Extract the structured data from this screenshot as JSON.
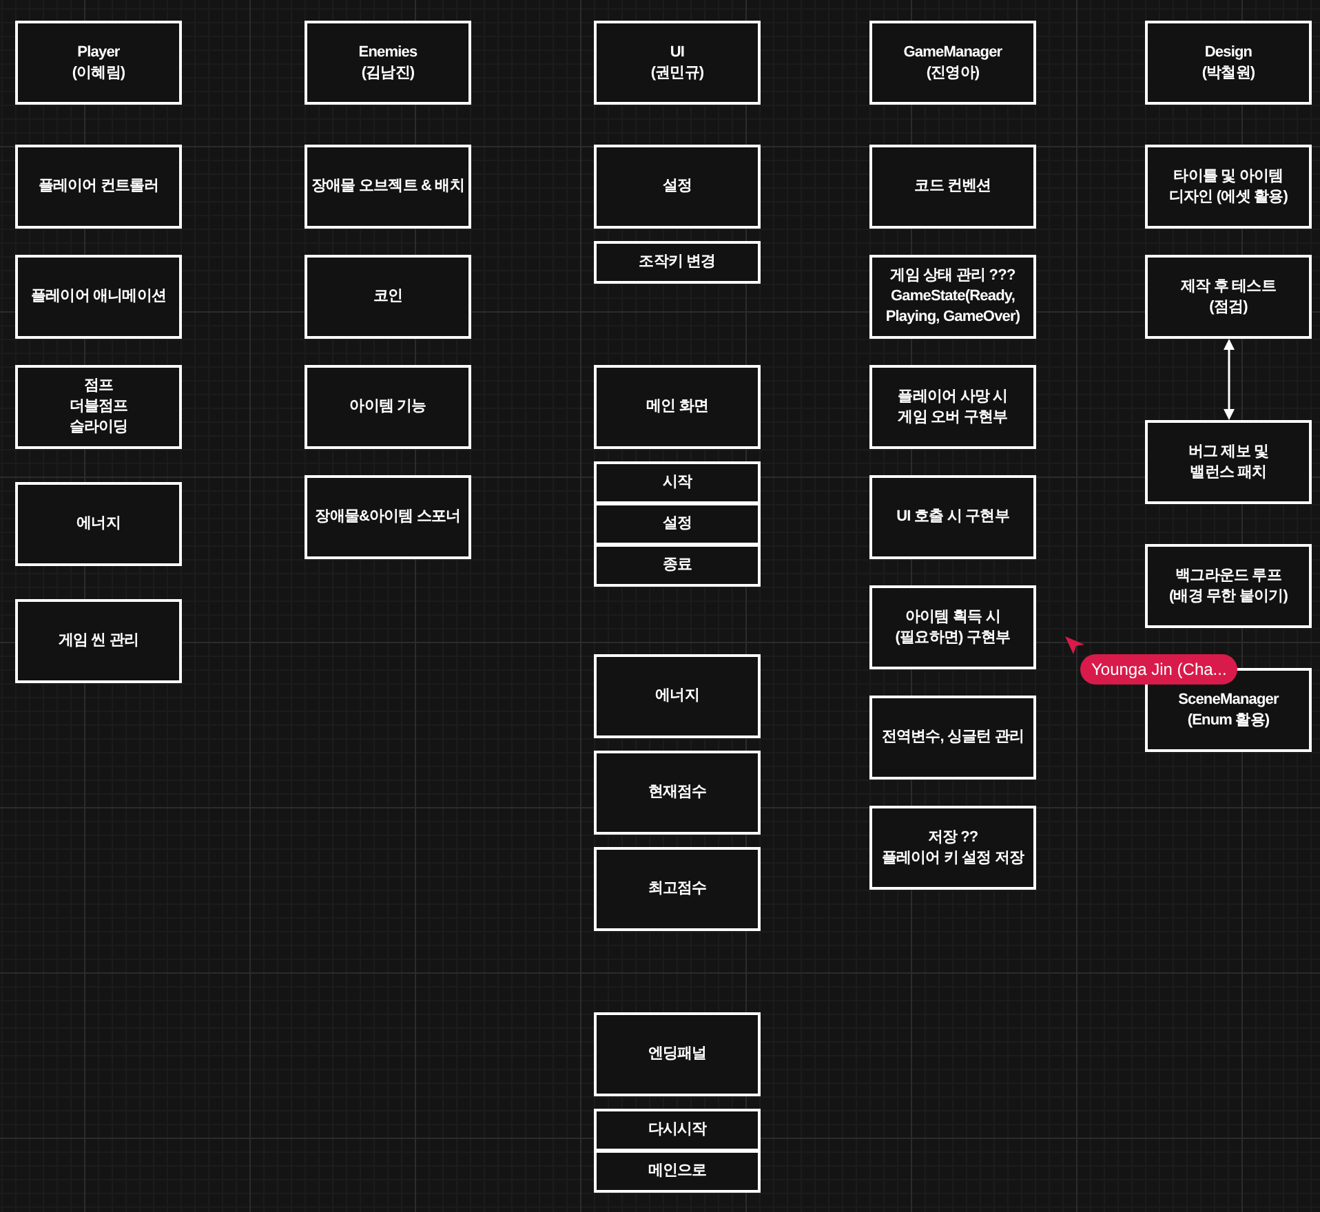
{
  "columns": [
    {
      "items": [
        {
          "kind": "box",
          "text": "Player\n(이혜림)"
        },
        {
          "kind": "box",
          "text": "플레이어 컨트롤러"
        },
        {
          "kind": "box",
          "text": "플레이어 애니메이션"
        },
        {
          "kind": "box",
          "text": "점프\n더블점프\n슬라이딩"
        },
        {
          "kind": "box",
          "text": "에너지"
        },
        {
          "kind": "box",
          "text": "게임 씬 관리"
        }
      ]
    },
    {
      "items": [
        {
          "kind": "box",
          "text": "Enemies\n(김남진)"
        },
        {
          "kind": "box",
          "text": "장애물 오브젝트 & 배치"
        },
        {
          "kind": "box",
          "text": "코인"
        },
        {
          "kind": "box",
          "text": "아이템 기능"
        },
        {
          "kind": "box",
          "text": "장애물&아이템 스포너"
        }
      ]
    },
    {
      "items": [
        {
          "kind": "box",
          "text": "UI\n(권민규)"
        },
        {
          "kind": "box",
          "text": "설정"
        },
        {
          "kind": "row",
          "text": "조작키 변경"
        },
        {
          "kind": "box",
          "text": "메인 화면"
        },
        {
          "kind": "row",
          "text": "시작"
        },
        {
          "kind": "row",
          "text": "설정"
        },
        {
          "kind": "row",
          "text": "종료"
        },
        {
          "kind": "box",
          "text": "에너지"
        },
        {
          "kind": "box",
          "text": "현재점수"
        },
        {
          "kind": "box",
          "text": "최고점수"
        },
        {
          "kind": "box",
          "text": "엔딩패널"
        },
        {
          "kind": "row",
          "text": "다시시작"
        },
        {
          "kind": "row",
          "text": "메인으로"
        }
      ]
    },
    {
      "items": [
        {
          "kind": "box",
          "text": "GameManager\n(진영아)"
        },
        {
          "kind": "box",
          "text": "코드 컨벤션"
        },
        {
          "kind": "box",
          "text": "게임 상태 관리 ???\nGameState(Ready,\nPlaying, GameOver)"
        },
        {
          "kind": "box",
          "text": "플레이어 사망 시\n게임 오버 구현부"
        },
        {
          "kind": "box",
          "text": "UI 호출 시 구현부"
        },
        {
          "kind": "box",
          "text": "아이템 획득 시\n(필요하면) 구현부"
        },
        {
          "kind": "box",
          "text": "전역변수, 싱글턴 관리"
        },
        {
          "kind": "box",
          "text": "저장 ??\n플레이어 키 설정 저장"
        }
      ]
    },
    {
      "items": [
        {
          "kind": "box",
          "text": "Design\n(박철원)"
        },
        {
          "kind": "box",
          "text": "타이틀 및 아이템\n디자인 (에셋 활용)"
        },
        {
          "kind": "box",
          "text": "제작 후 테스트\n(점검)",
          "two_way_arrow_below": true
        },
        {
          "kind": "box",
          "text": "버그 제보 및\n밸런스 패치"
        },
        {
          "kind": "box",
          "text": "백그라운드 루프\n(배경 무한 붙이기)"
        },
        {
          "kind": "box",
          "text": "SceneManager\n(Enum 활용)"
        }
      ]
    }
  ],
  "collaborator_cursor": {
    "name": "Younga Jin (Cha...",
    "color": "#d81b4a"
  }
}
